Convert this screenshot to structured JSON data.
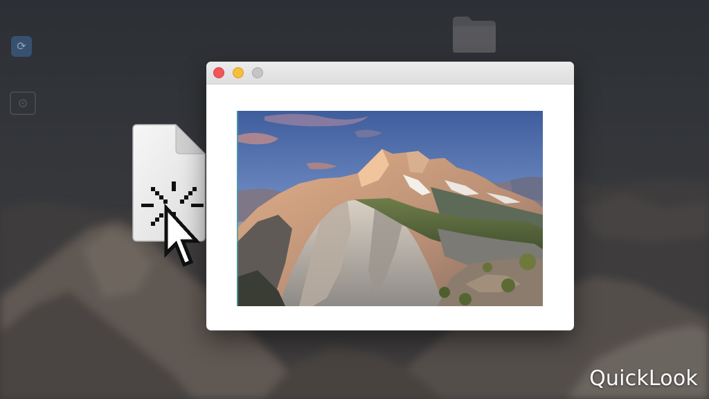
{
  "desktop": {
    "background": "blurred-mountain-landscape",
    "icons": [
      {
        "icon": "app-icon"
      },
      {
        "icon": "settings-icon"
      },
      {
        "icon": "folder-icon"
      }
    ]
  },
  "dragged_file": {
    "icon": "image-file-icon",
    "cursor": "click-pointer-cursor"
  },
  "quicklook_window": {
    "traffic_lights": {
      "close": "#f0565a",
      "minimize": "#f5be3b",
      "zoom": "#c5c5c5"
    },
    "preview": "mountain-sunset-photo"
  },
  "caption": "QuickLook"
}
